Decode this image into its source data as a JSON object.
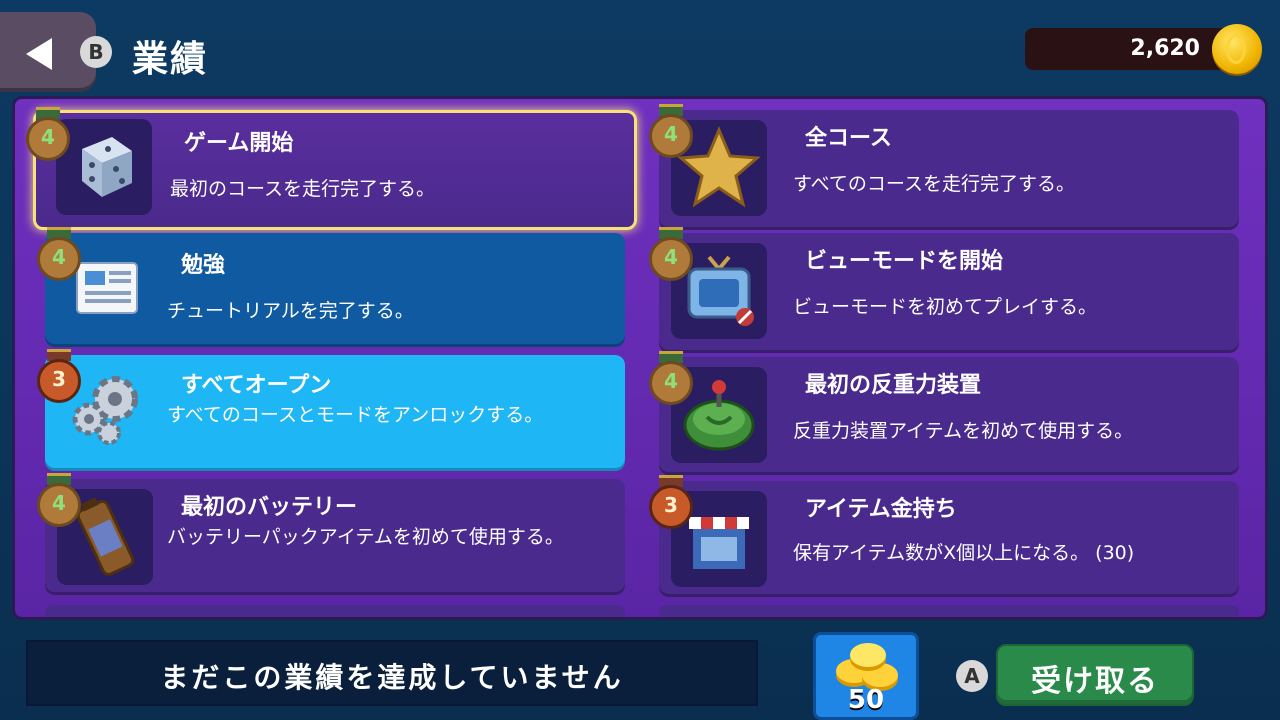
{
  "header": {
    "title": "業績",
    "b_key": "B",
    "coins": "2,620"
  },
  "achievements": [
    {
      "title": "ゲーム開始",
      "desc": "最初のコースを走行完了する。",
      "rank": "4",
      "icon": "dice-icon"
    },
    {
      "title": "全コース",
      "desc": "すべてのコースを走行完了する。",
      "rank": "4",
      "icon": "star-icon"
    },
    {
      "title": "勉強",
      "desc": "チュートリアルを完了する。",
      "rank": "4",
      "icon": "newspaper-icon"
    },
    {
      "title": "ビューモードを開始",
      "desc": "ビューモードを初めてプレイする。",
      "rank": "4",
      "icon": "tv-icon"
    },
    {
      "title": "すべてオープン",
      "desc": "すべてのコースとモードをアンロックする。",
      "rank": "3",
      "icon": "gears-icon"
    },
    {
      "title": "最初の反重力装置",
      "desc": "反重力装置アイテムを初めて使用する。",
      "rank": "4",
      "icon": "antigravity-device-icon"
    },
    {
      "title": "最初のバッテリー",
      "desc": "バッテリーパックアイテムを初めて使用する。",
      "rank": "4",
      "icon": "battery-icon"
    },
    {
      "title": "アイテム金持ち",
      "desc": "保有アイテム数がX個以上になる。 (30)",
      "rank": "3",
      "icon": "shop-stall-icon"
    }
  ],
  "footer": {
    "status": "まだこの業績を達成していません",
    "reward": "50",
    "a_key": "A",
    "claim_label": "受け取る"
  }
}
